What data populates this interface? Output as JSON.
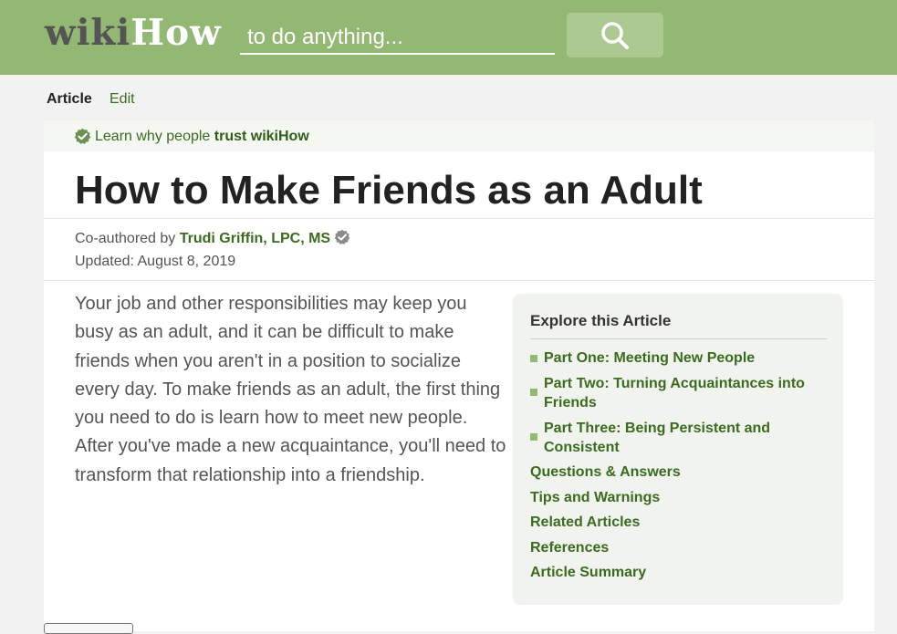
{
  "header": {
    "logo_wiki": "wiki",
    "logo_how": "How",
    "search_placeholder": "to do anything...",
    "search_icon": "magnifier-icon"
  },
  "tabs": {
    "article": "Article",
    "edit": "Edit"
  },
  "trust": {
    "prefix": "Learn why people ",
    "link": "trust wikiHow"
  },
  "article": {
    "title": "How to Make Friends as an Adult",
    "coauthored_label": "Co-authored by",
    "author": "Trudi Griffin, LPC, MS",
    "updated": "Updated: August 8, 2019",
    "intro": "Your job and other responsibilities may keep you busy as an adult, and it can be difficult to make friends when you aren't in a position to socialize every day. To make friends as an adult, the first thing you need to do is learn how to meet new people. After you've made a new acquaintance, you'll need to transform that relationship into a friendship."
  },
  "toc": {
    "title": "Explore this Article",
    "parts": [
      "Part One: Meeting New People",
      "Part Two: Turning Acquaintances into Friends",
      "Part Three: Being Persistent and Consistent"
    ],
    "links": [
      "Questions & Answers",
      "Tips and Warnings",
      "Related Articles",
      "References",
      "Article Summary"
    ]
  },
  "colors": {
    "header_green": "#93b874",
    "link_green": "#3b6b1f"
  }
}
